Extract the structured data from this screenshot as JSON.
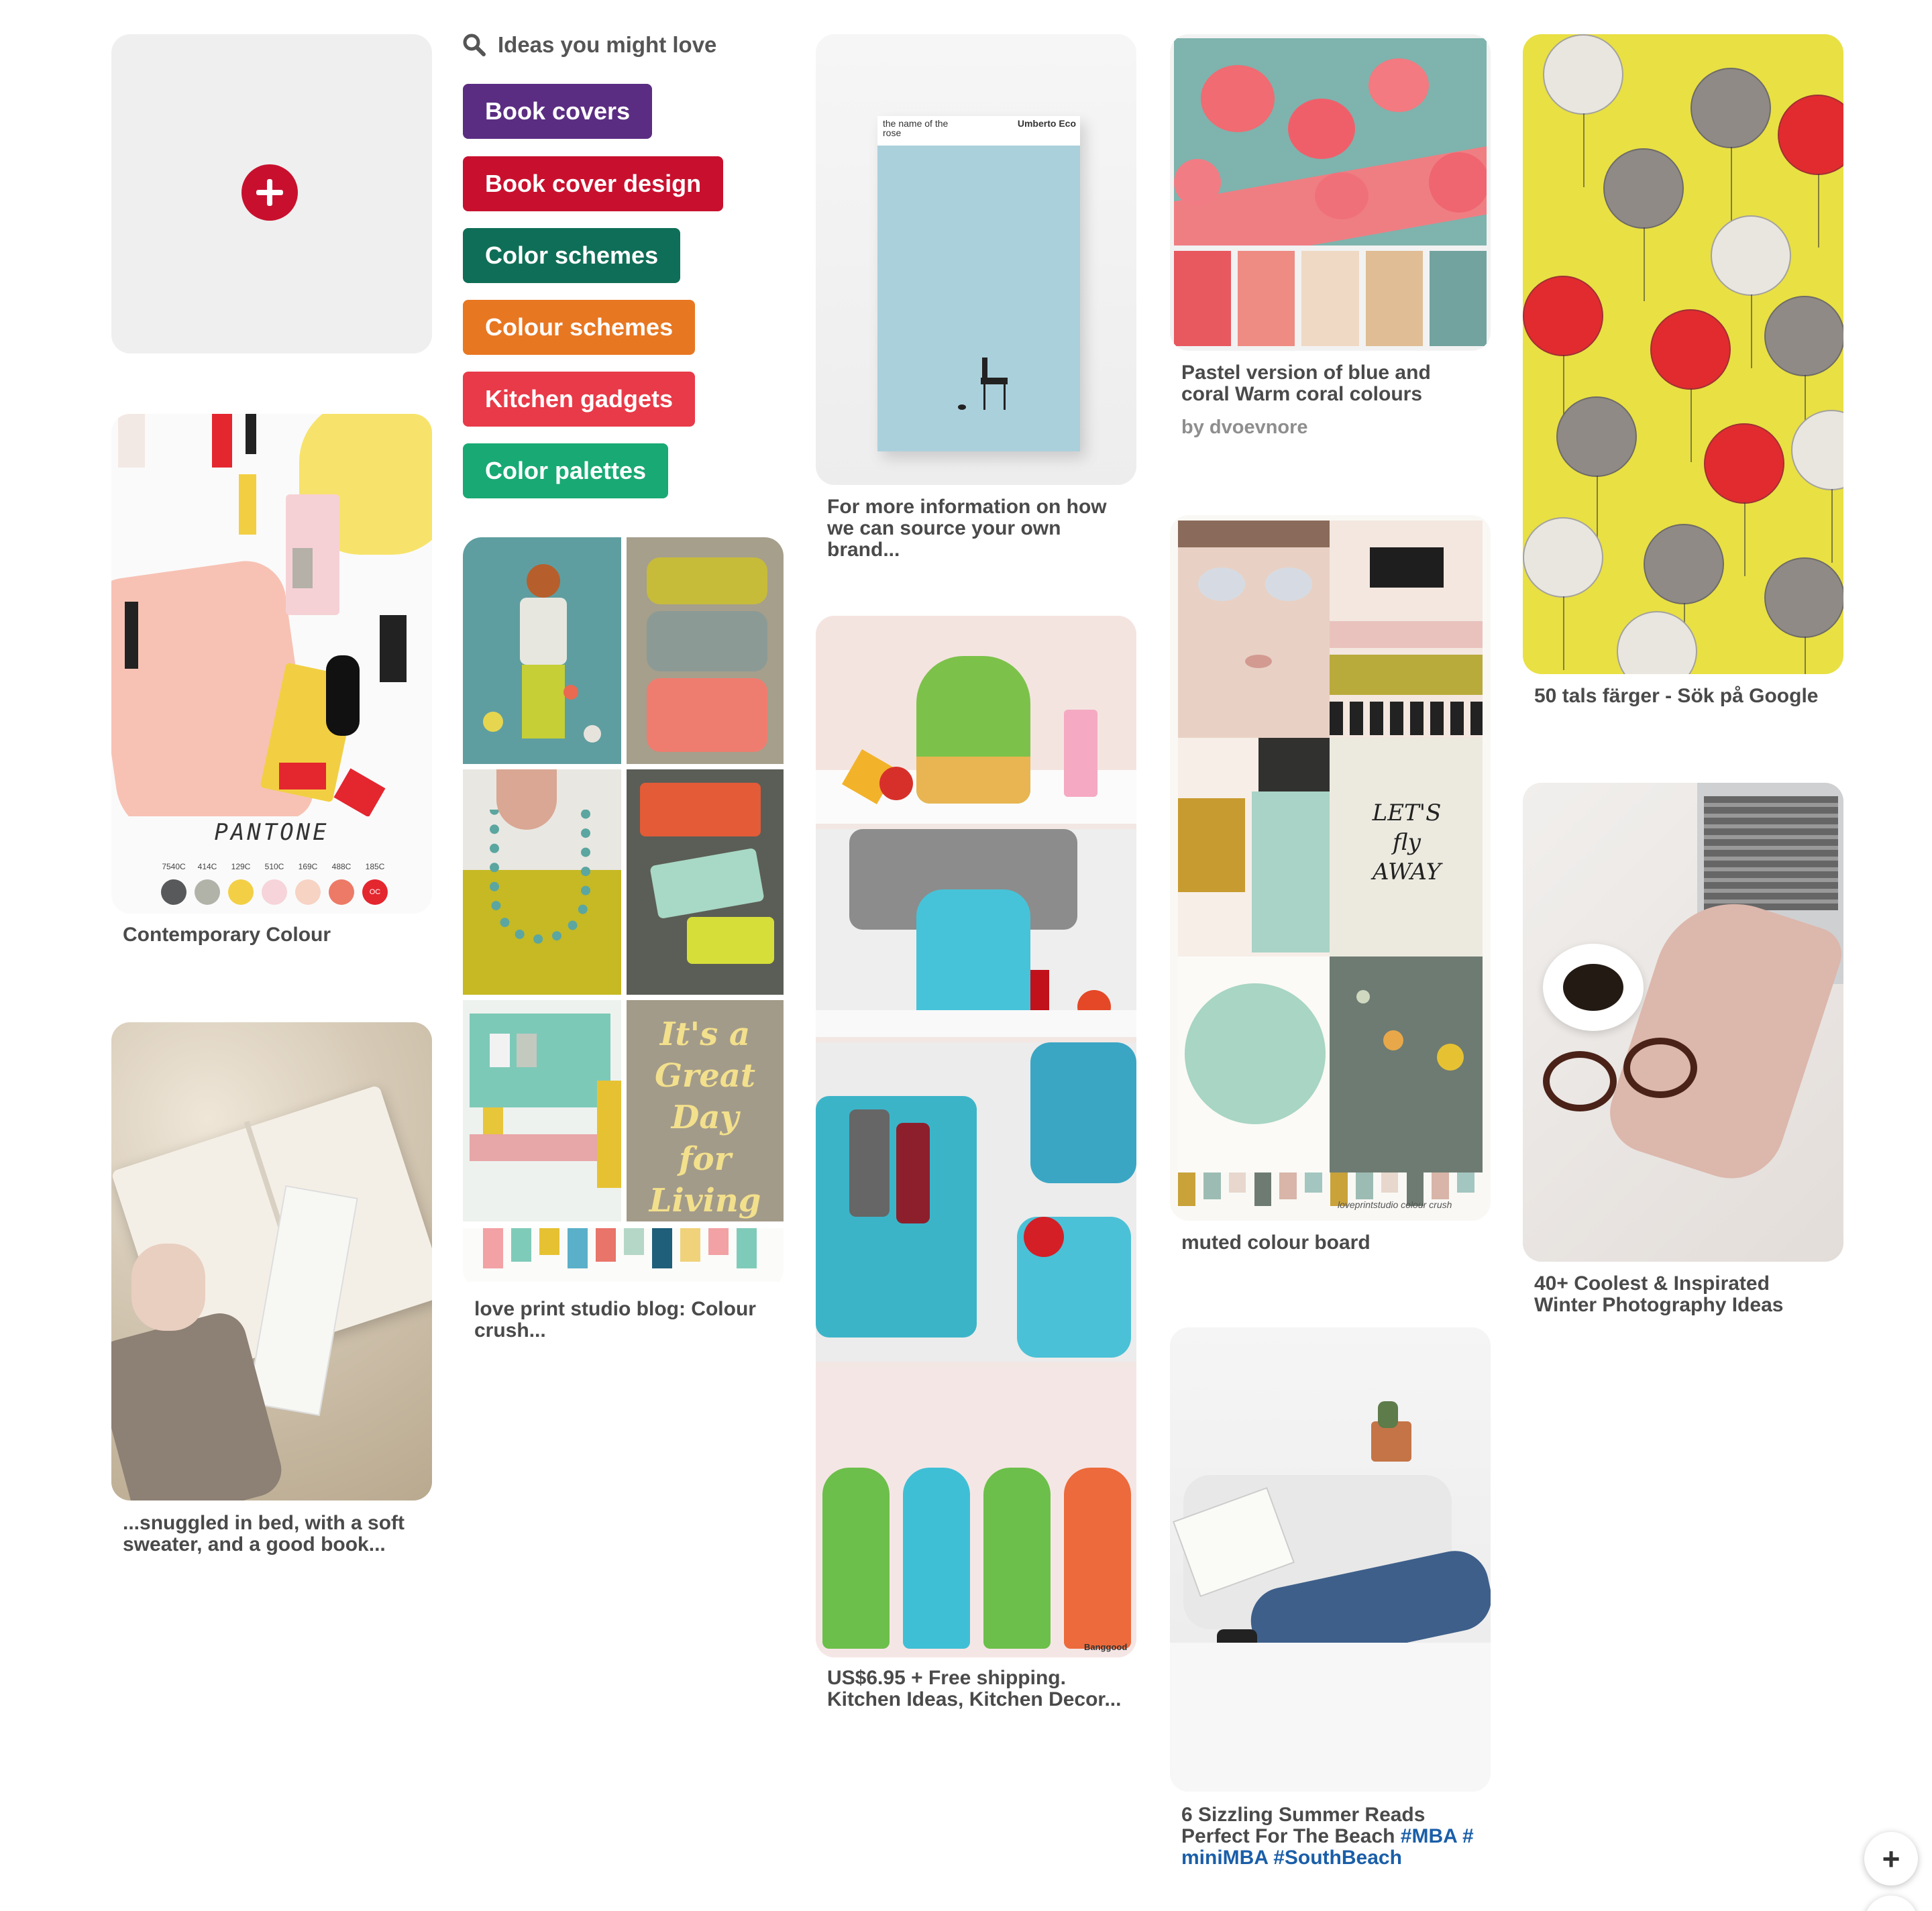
{
  "ideas": {
    "header": "Ideas you might love",
    "chips": [
      {
        "label": "Book covers",
        "color": "#5b2d82"
      },
      {
        "label": "Book cover design",
        "color": "#c8102e"
      },
      {
        "label": "Color schemes",
        "color": "#0f6e57"
      },
      {
        "label": "Colour schemes",
        "color": "#e87722"
      },
      {
        "label": "Kitchen gadgets",
        "color": "#e83a48"
      },
      {
        "label": "Color palettes",
        "color": "#19a974"
      }
    ]
  },
  "pins": {
    "contemporary": {
      "caption": "Contemporary Colour",
      "brand": "PANTONE",
      "swatch_codes": [
        "7540C",
        "414C",
        "129C",
        "510C",
        "169C",
        "488C",
        "185C"
      ],
      "swatch_colors": [
        "#58595b",
        "#b1b3a8",
        "#f3cf45",
        "#f6d4d9",
        "#f7d3c4",
        "#ec7a66",
        "#e4262f"
      ],
      "badge": "OC"
    },
    "bed_book": {
      "caption": "...snuggled in bed, with a soft sweater, and a good book..."
    },
    "love_print": {
      "caption": "love print studio blog: Colour crush..."
    },
    "rose_book": {
      "caption": "For more information on how we can source your own brand...",
      "cover_title": "the name of the rose",
      "cover_author": "Umberto Eco"
    },
    "lunch_bags": {
      "caption": "US$6.95 + Free shipping. Kitchen Ideas, Kitchen Decor...",
      "watermark": "Banggood"
    },
    "lanterns": {
      "caption": "Pastel version of blue and coral Warm coral colours",
      "byline": "by dvoevnore",
      "palette": [
        "#e8585f",
        "#ee8b83",
        "#efd9c4",
        "#e0bd94",
        "#72a39f"
      ]
    },
    "muted_board": {
      "caption": "muted colour board",
      "sign_text": "LET'S fly AWAY",
      "footer": "loveprintstudio colour crush"
    },
    "summer_reads": {
      "caption_text": "6 Sizzling Summer Reads Perfect For The Beach ",
      "tags": "#MBA #miniMBA #SouthBeach"
    },
    "fifties": {
      "caption": "50 tals färger - Sök på Google"
    },
    "winter": {
      "caption": "40+ Coolest & Inspirated Winter Photography Ideas"
    }
  },
  "fab": {
    "add": "+",
    "help": "?"
  }
}
